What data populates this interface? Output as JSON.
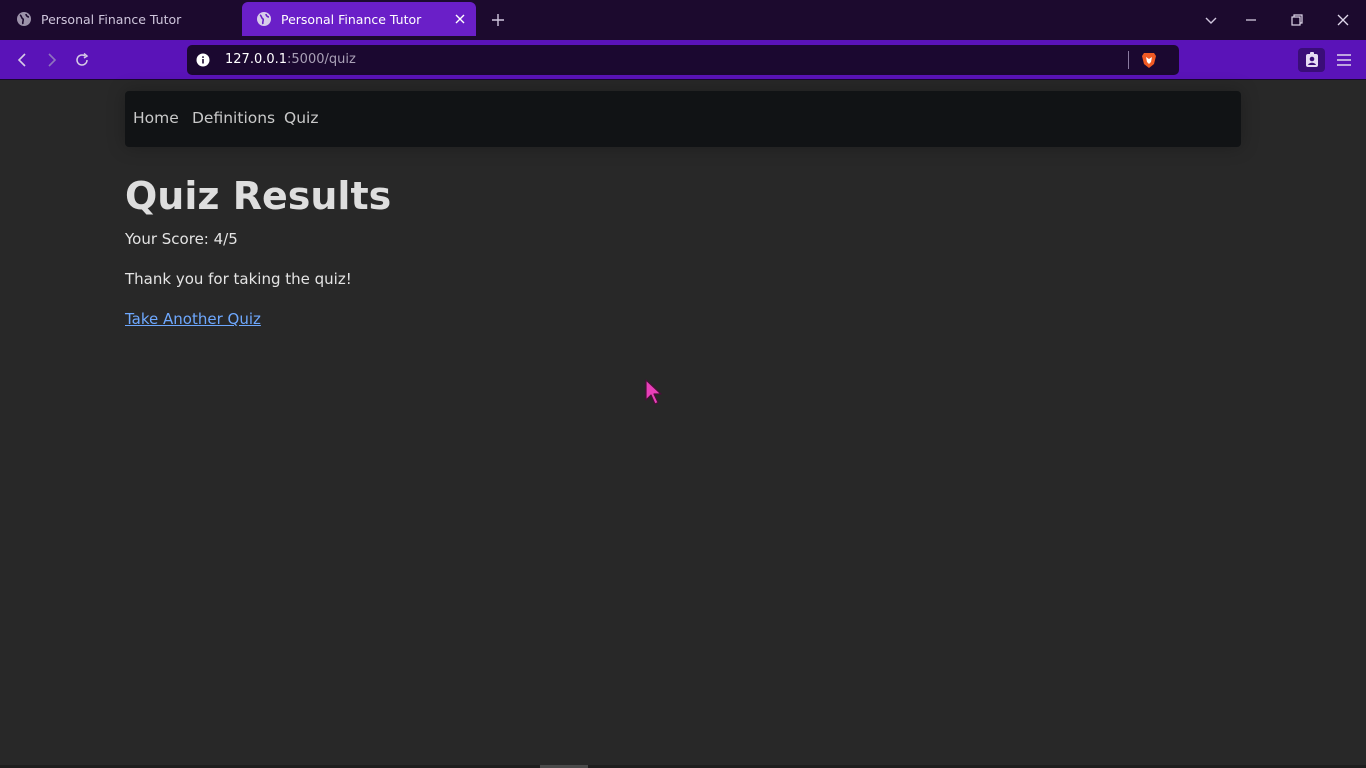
{
  "browser": {
    "tabs": [
      {
        "title": "Personal Finance Tutor",
        "active": false,
        "icon": "globe-icon"
      },
      {
        "title": "Personal Finance Tutor",
        "active": true,
        "icon": "globe-icon"
      }
    ],
    "url_host": "127.0.0.1",
    "url_path": ":5000/quiz",
    "colors": {
      "tabstrip": "#1c0a2e",
      "active_tab": "#6a1fc8",
      "toolbar": "#5a13b8",
      "omnibox": "#1b0830"
    }
  },
  "navbar": {
    "links": [
      "Home",
      "Definitions",
      "Quiz"
    ]
  },
  "main": {
    "title": "Quiz Results",
    "score_text": "Your Score: 4/5",
    "thanks_text": "Thank you for taking the quiz!",
    "again_link": "Take Another Quiz"
  },
  "colors": {
    "page_bg": "#282828",
    "navbar_bg": "#111315",
    "link": "#6ea8fe",
    "cursor": "#e83fb8"
  }
}
